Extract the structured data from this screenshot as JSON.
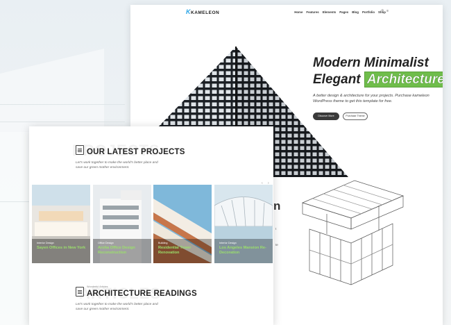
{
  "right_page": {
    "logo": "KAMELEON",
    "nav": [
      "Home",
      "Features",
      "Elements",
      "Pages",
      "Blog",
      "Portfolio",
      "Shop"
    ],
    "hero": {
      "title_line1": "Modern Minimalist",
      "title_line2_prefix": "Elegant",
      "title_line2_highlight": "Architecture",
      "subtitle": "A better design & architecture for your projects. Purchase kameleon WordPress theme to get this template for free.",
      "btn_primary": "Discover More",
      "btn_secondary": "Purchase Theme"
    },
    "partial_heading": "n",
    "partial_text_1": "t",
    "partial_text_2": "te"
  },
  "left_page": {
    "projects_section": {
      "watermark": "PROJECTS",
      "title": "OUR LATEST PROJECTS",
      "desc": "Let's work together to make the world's better place and save our green mother environment."
    },
    "projects": [
      {
        "category": "Interior Design",
        "title": "Sayen Offices in New York"
      },
      {
        "category": "Office Design",
        "title": "Aroha Office Design Reconstruction"
      },
      {
        "category": "Building",
        "title": "Residential Tower Renovation"
      },
      {
        "category": "Interior Design",
        "title": "Los Angeles Mansion Re-Decoration"
      }
    ],
    "readings_section": {
      "label": "Wonderful Articles",
      "watermark": "ARTICLES",
      "title": "ARCHITECTURE READINGS",
      "desc": "Let's work together to make the world's better place and save our green mother environment."
    }
  },
  "colors": {
    "accent_green": "#6fbd4b",
    "logo_blue": "#2aa4e6",
    "project_title_green": "#9be06b"
  }
}
